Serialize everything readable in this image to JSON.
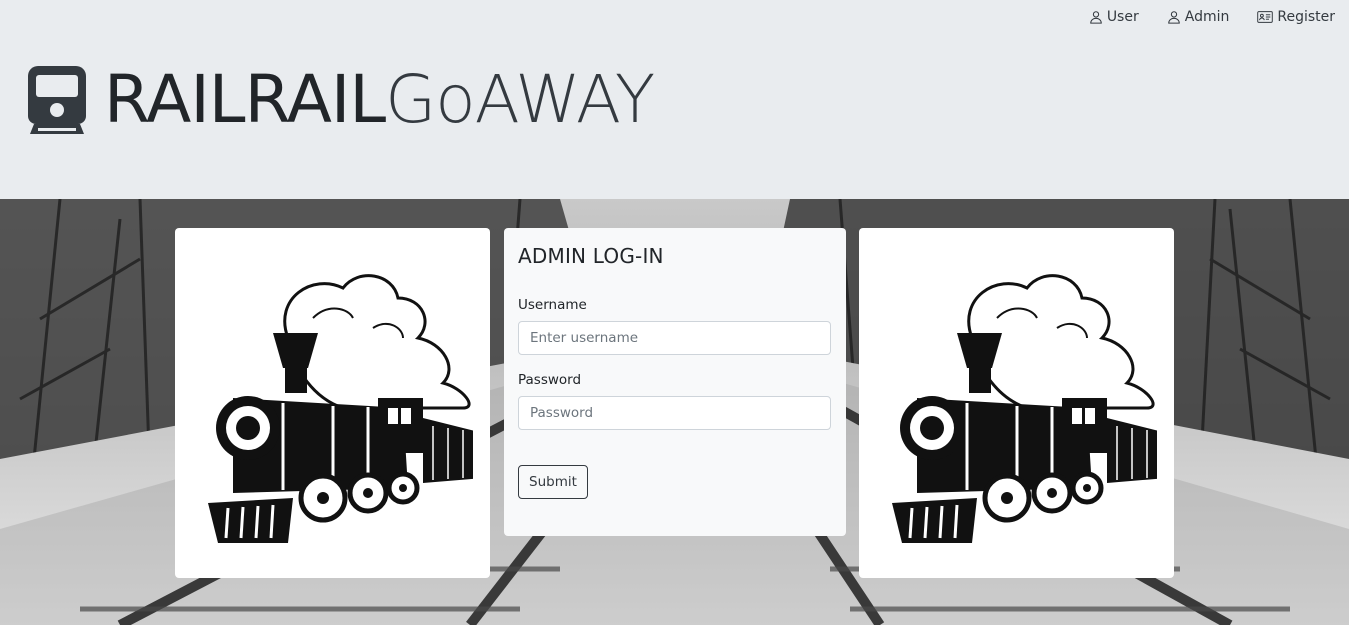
{
  "nav": {
    "items": [
      {
        "label": "User",
        "icon": "person-icon"
      },
      {
        "label": "Admin",
        "icon": "person-icon"
      },
      {
        "label": "Register",
        "icon": "id-card-icon"
      }
    ]
  },
  "brand": {
    "part_bold": "RAILRAIL",
    "part_light": "GoAWAY",
    "icon": "train-front-icon"
  },
  "login": {
    "title": "ADMIN LOG-IN",
    "username_label": "Username",
    "username_placeholder": "Enter username",
    "username_value": "",
    "password_label": "Password",
    "password_placeholder": "Password",
    "password_value": "",
    "submit_label": "Submit"
  },
  "colors": {
    "header_bg": "#e9ecef",
    "card_bg": "#f8f9fa",
    "text": "#212529",
    "input_border": "#ced4da"
  },
  "images": {
    "left": "steam-locomotive-illustration",
    "right": "steam-locomotive-illustration",
    "background": "snowy-railway-tracks-photo"
  }
}
